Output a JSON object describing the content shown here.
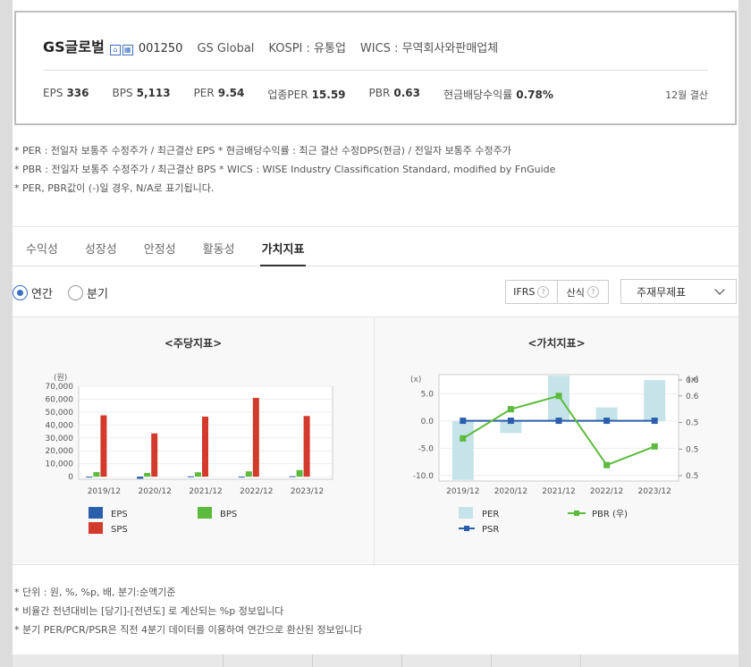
{
  "company": {
    "name": "GS글로벌",
    "code": "001250",
    "english_name": "GS Global",
    "market": "KOSPI : 유통업",
    "wics": "WICS : 무역회사와판매업체"
  },
  "metrics": [
    {
      "label": "EPS",
      "value": "336"
    },
    {
      "label": "BPS",
      "value": "5,113"
    },
    {
      "label": "PER",
      "value": "9.54"
    },
    {
      "label": "업종PER",
      "value": "15.59"
    },
    {
      "label": "PBR",
      "value": "0.63"
    },
    {
      "label": "현금배당수익률",
      "value": "0.78%"
    }
  ],
  "settlement": "12월 결산",
  "notes": [
    "* PER : 전일자 보통주 수정주가 / 최근결산 EPS * 현금배당수익률 : 최근 결산 수정DPS(현금) / 전일자 보통주 수정주가",
    "* PBR : 전일자 보통주 수정주가 / 최근결산 BPS * WICS : WISE Industry Classification Standard, modified by FnGuide",
    "* PER, PBR값이 (-)일 경우, N/A로 표기됩니다."
  ],
  "tabs": [
    "수익성",
    "성장성",
    "안정성",
    "활동성",
    "가치지표"
  ],
  "active_tab": "가치지표",
  "period": {
    "annual": "연간",
    "quarterly": "분기"
  },
  "toggles": {
    "ifrs": "IFRS",
    "calc": "산식",
    "q": "?"
  },
  "select_label": "주재무제표",
  "chart_data": [
    {
      "type": "bar",
      "title": "<주당지표>",
      "ylabel": "(원)",
      "categories": [
        "2019/12",
        "2020/12",
        "2021/12",
        "2022/12",
        "2023/12"
      ],
      "yticks": [
        "70,000",
        "60,000",
        "50,000",
        "40,000",
        "30,000",
        "20,000",
        "10,000",
        "0"
      ],
      "ylim": [
        -2000,
        70000
      ],
      "series": [
        {
          "name": "EPS",
          "color": "#2b5fad",
          "values": [
            -200,
            -1600,
            200,
            -300,
            336
          ]
        },
        {
          "name": "BPS",
          "color": "#5cbb3c",
          "values": [
            3500,
            2900,
            3400,
            4100,
            5113
          ]
        },
        {
          "name": "SPS",
          "color": "#d23a2b",
          "values": [
            47500,
            33500,
            46500,
            61000,
            47000
          ]
        }
      ]
    },
    {
      "type": "bar+line",
      "title": "<가치지표>",
      "y_left_label": "(x)",
      "y_right_label": "(x)",
      "categories": [
        "2019/12",
        "2020/12",
        "2021/12",
        "2022/12",
        "2023/12"
      ],
      "y_left_ticks": [
        "5.0",
        "0.0",
        "-5.0",
        "-10.0"
      ],
      "y_left_lim": [
        -11,
        8.5
      ],
      "y_right_ticks": [
        "0.6",
        "0.6",
        "0.5",
        "0.5",
        "0.5"
      ],
      "y_right_lim": [
        0.43,
        0.63
      ],
      "series": [
        {
          "name": "PER",
          "kind": "bar",
          "axis": "left",
          "color": "#c6e3ea",
          "values": [
            -10.8,
            -2.2,
            8.3,
            2.5,
            7.5
          ]
        },
        {
          "name": "PBR (우)",
          "kind": "line",
          "axis": "right",
          "color": "#5cbb3c",
          "values": [
            0.51,
            0.565,
            0.59,
            0.46,
            0.495
          ]
        },
        {
          "name": "PSR",
          "kind": "line",
          "axis": "left",
          "color": "#2b5fad",
          "values": [
            0.05,
            0.05,
            0.05,
            0.05,
            0.05
          ]
        }
      ]
    }
  ],
  "footnotes": [
    "* 단위 : 원, %, %p, 배, 분기:순액기준",
    "* 비율간 전년대비는 [당기]-[전년도] 로 계산되는 %p 정보입니다",
    "* 분기 PER/PCR/PSR은 직전 4분기 데이터를 이용하여 연간으로 환산된 정보입니다"
  ]
}
